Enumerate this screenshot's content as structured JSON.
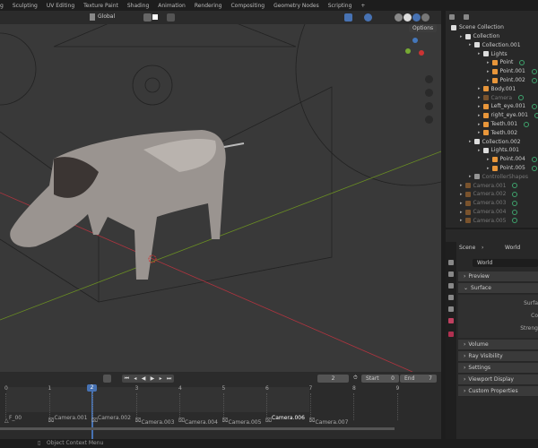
{
  "workspace_tabs": [
    "g",
    "Sculpting",
    "UV Editing",
    "Texture Paint",
    "Shading",
    "Animation",
    "Rendering",
    "Compositing",
    "Geometry Nodes",
    "Scripting",
    "+"
  ],
  "viewport_header": {
    "transform_orientation": "Global",
    "options_label": "Options"
  },
  "outliner": {
    "items": [
      {
        "label": "Scene Collection",
        "depth": 0,
        "type": "collection"
      },
      {
        "label": "Collection",
        "depth": 1,
        "type": "collection"
      },
      {
        "label": "Collection.001",
        "depth": 2,
        "type": "collection"
      },
      {
        "label": "Lights",
        "depth": 3,
        "type": "collection"
      },
      {
        "label": "Point",
        "depth": 4,
        "type": "light"
      },
      {
        "label": "Point.001",
        "depth": 4,
        "type": "light"
      },
      {
        "label": "Point.002",
        "depth": 4,
        "type": "light"
      },
      {
        "label": "Body.001",
        "depth": 3,
        "type": "mesh"
      },
      {
        "label": "Camera",
        "depth": 3,
        "type": "camera",
        "dim": true
      },
      {
        "label": "Left_eye.001",
        "depth": 3,
        "type": "mesh"
      },
      {
        "label": "right_eye.001",
        "depth": 3,
        "type": "mesh"
      },
      {
        "label": "Teeth.001",
        "depth": 3,
        "type": "mesh"
      },
      {
        "label": "Teeth.002",
        "depth": 3,
        "type": "mesh"
      },
      {
        "label": "Collection.002",
        "depth": 2,
        "type": "collection"
      },
      {
        "label": "Lights.001",
        "depth": 3,
        "type": "collection"
      },
      {
        "label": "Point.004",
        "depth": 4,
        "type": "light"
      },
      {
        "label": "Point.005",
        "depth": 4,
        "type": "light"
      },
      {
        "label": "ControllerShapes",
        "depth": 2,
        "type": "collection",
        "dim": true
      },
      {
        "label": "Camera.001",
        "depth": 1,
        "type": "camera",
        "dim": true
      },
      {
        "label": "Camera.002",
        "depth": 1,
        "type": "camera",
        "dim": true
      },
      {
        "label": "Camera.003",
        "depth": 1,
        "type": "camera",
        "dim": true
      },
      {
        "label": "Camera.004",
        "depth": 1,
        "type": "camera",
        "dim": true
      },
      {
        "label": "Camera.005",
        "depth": 1,
        "type": "camera",
        "dim": true
      }
    ]
  },
  "properties": {
    "breadcrumb": [
      "Scene",
      "World"
    ],
    "world_name": "World",
    "panels": [
      "Preview",
      "Surface",
      "Volume",
      "Ray Visibility",
      "Settings",
      "Viewport Display",
      "Custom Properties"
    ],
    "surface_fields": [
      "Surfa",
      "Co",
      "Streng"
    ]
  },
  "timeline": {
    "current_frame": "2",
    "start_label": "Start",
    "start": "0",
    "end_label": "End",
    "end": "7",
    "ticks": [
      "0",
      "1",
      "2",
      "3",
      "4",
      "5",
      "6",
      "7",
      "8",
      "9"
    ],
    "markers": [
      "F_00",
      "Camera.001",
      "Camera.002",
      "Camera.003",
      "Camera.004",
      "Camera.005",
      "Camera.006",
      "Camera.007"
    ]
  },
  "status": {
    "hint": "Object Context Menu"
  },
  "colors": {
    "accent": "#4772b3",
    "light": "#e8963a",
    "mesh": "#e8963a",
    "green": "#3ea36d"
  }
}
